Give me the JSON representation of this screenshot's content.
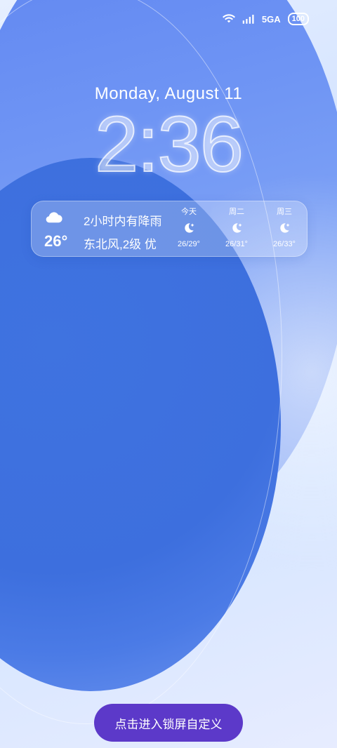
{
  "statusbar": {
    "network": "5GA",
    "battery": "100",
    "wifi_icon": "wifi-icon",
    "signal_icon": "signal-icon"
  },
  "lockscreen": {
    "date": "Monday, August 11",
    "time": "2:36"
  },
  "weather": {
    "icon": "cloud-icon",
    "title": "2小时内有降雨",
    "temperature": "26°",
    "detail": "东北风,2级 优",
    "forecast": [
      {
        "day": "今天",
        "icon": "moon-star-icon",
        "range": "26/29°"
      },
      {
        "day": "周二",
        "icon": "moon-star-icon",
        "range": "26/31°"
      },
      {
        "day": "周三",
        "icon": "moon-star-icon",
        "range": "26/33°"
      }
    ]
  },
  "actions": {
    "customize_label": "点击进入锁屏自定义"
  }
}
